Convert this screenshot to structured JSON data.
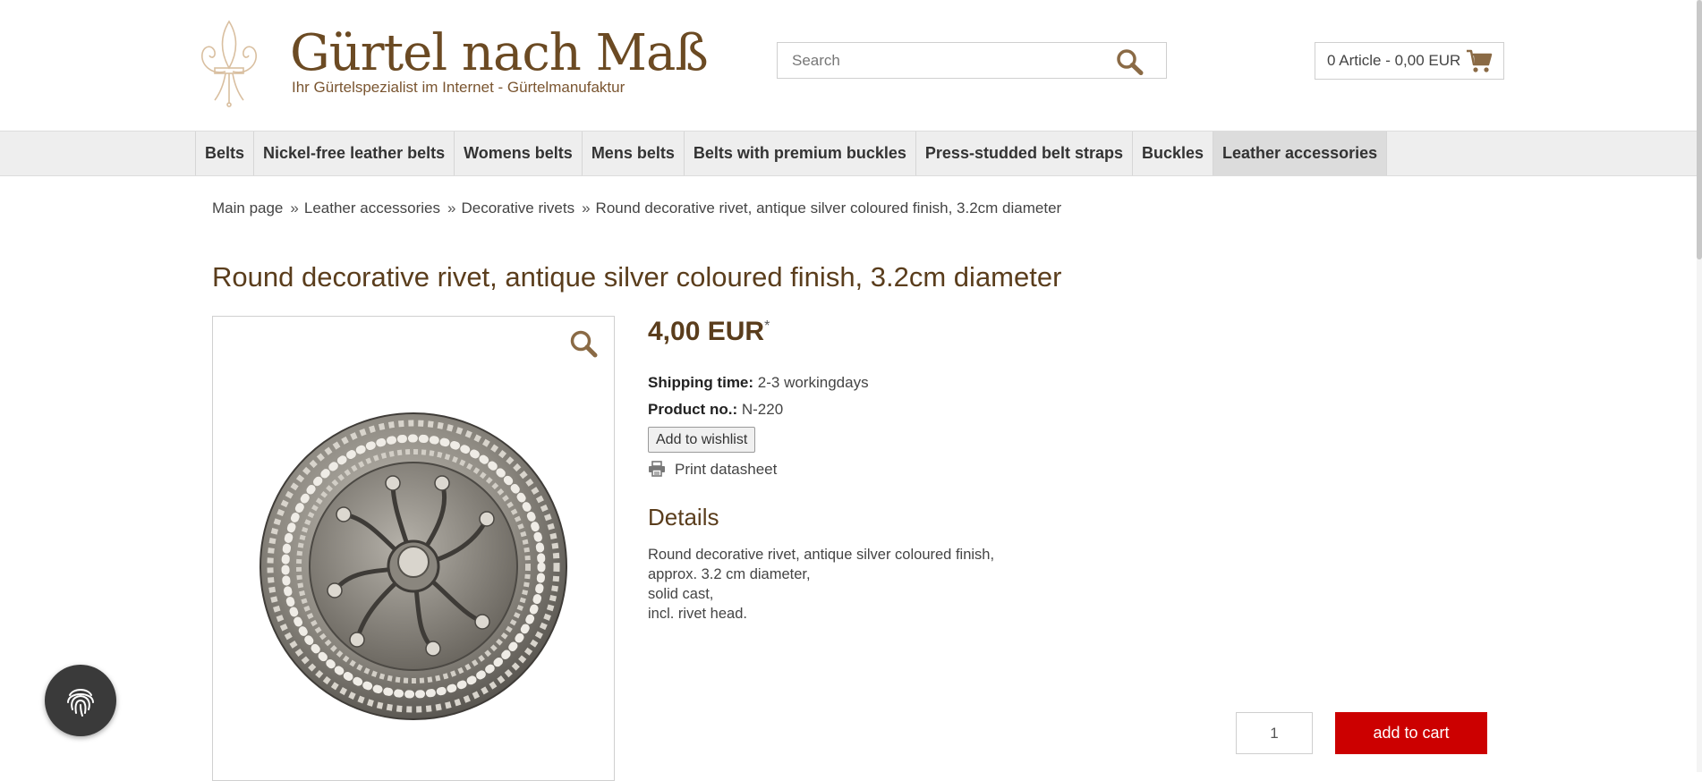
{
  "header": {
    "logo_title": "Gürtel nach Maß",
    "logo_subtitle": "Ihr Gürtelspezialist im Internet - Gürtelmanufaktur",
    "search_placeholder": "Search",
    "cart_label": "0 Article - 0,00 EUR",
    "icons": {
      "logo": "fleur-de-lis-icon",
      "search": "search-icon",
      "cart": "cart-icon"
    }
  },
  "nav": {
    "items": [
      {
        "label": "Belts",
        "active": false
      },
      {
        "label": "Nickel-free leather belts",
        "active": false
      },
      {
        "label": "Womens belts",
        "active": false
      },
      {
        "label": "Mens belts",
        "active": false
      },
      {
        "label": "Belts with premium buckles",
        "active": false
      },
      {
        "label": "Press-studded belt straps",
        "active": false
      },
      {
        "label": "Buckles",
        "active": false
      },
      {
        "label": "Leather accessories",
        "active": true
      }
    ]
  },
  "breadcrumb": {
    "items": [
      "Main page",
      "Leather accessories",
      "Decorative rivets",
      "Round decorative rivet, antique silver coloured finish, 3.2cm diameter"
    ],
    "separator": "»"
  },
  "product": {
    "title": "Round decorative rivet, antique silver coloured finish, 3.2cm diameter",
    "price": "4,00 EUR",
    "price_footnote": "*",
    "shipping_label": "Shipping time:",
    "shipping_value": "2-3 workingdays",
    "product_no_label": "Product no.:",
    "product_no_value": "N-220",
    "wishlist_label": "Add to wishlist",
    "print_label": "Print datasheet",
    "details_heading": "Details",
    "description_lines": [
      "Round decorative rivet, antique silver coloured finish,",
      "approx. 3.2 cm diameter,",
      "solid cast,",
      "incl. rivet head."
    ],
    "quantity": "1",
    "add_to_cart_label": "add to cart"
  },
  "colors": {
    "brand_brown": "#5a3d1c",
    "cart_red": "#cc0000",
    "nav_bg": "#eeeeee",
    "nav_active_bg": "#dcdcdc"
  }
}
